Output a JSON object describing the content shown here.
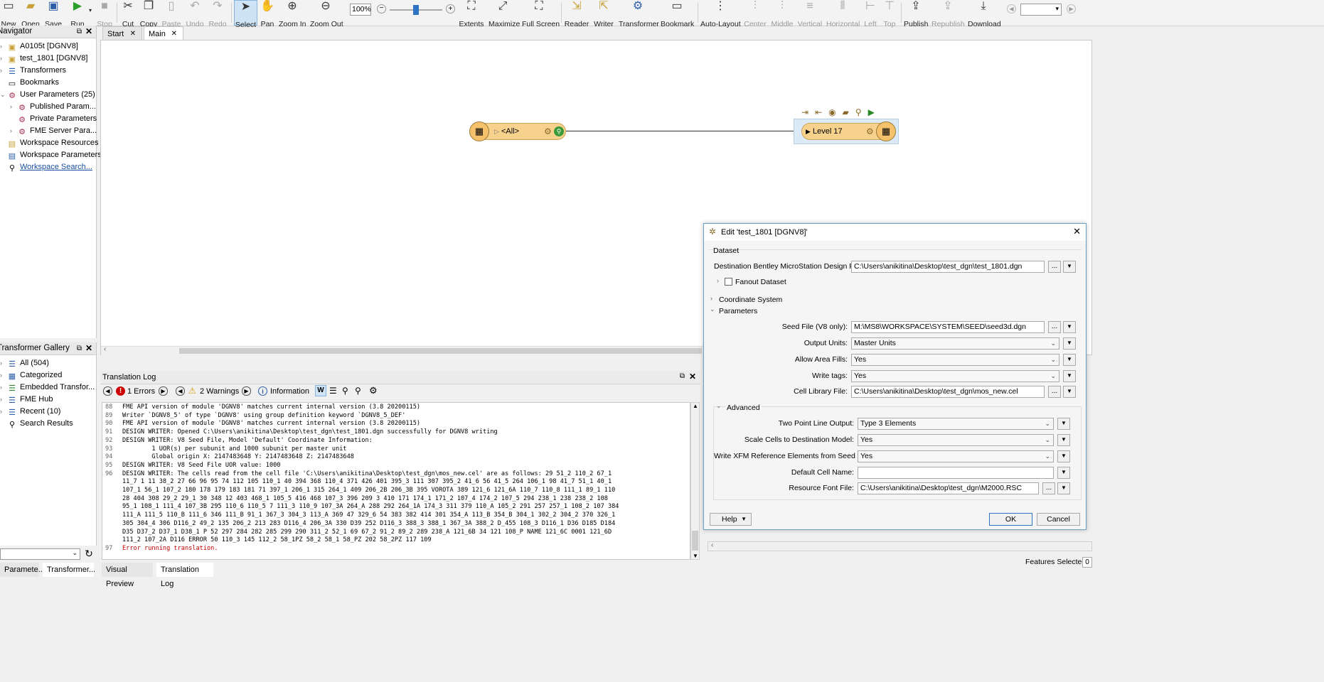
{
  "toolbar": {
    "items": [
      {
        "label": "New"
      },
      {
        "label": "Open"
      },
      {
        "label": "Save"
      },
      {
        "label": "Run"
      },
      {
        "label": "Stop"
      },
      {
        "label": "Cut"
      },
      {
        "label": "Copy"
      },
      {
        "label": "Paste"
      },
      {
        "label": "Undo"
      },
      {
        "label": "Redo"
      },
      {
        "label": "Select"
      },
      {
        "label": "Pan"
      },
      {
        "label": "Zoom In"
      },
      {
        "label": "Zoom Out"
      },
      {
        "label": "Extents"
      },
      {
        "label": "Maximize"
      },
      {
        "label": "Full Screen"
      },
      {
        "label": "Reader"
      },
      {
        "label": "Writer"
      },
      {
        "label": "Transformer"
      },
      {
        "label": "Bookmark"
      },
      {
        "label": "Auto-Layout"
      },
      {
        "label": "Center"
      },
      {
        "label": "Middle"
      },
      {
        "label": "Vertical"
      },
      {
        "label": "Horizontal"
      },
      {
        "label": "Left"
      },
      {
        "label": "Top"
      },
      {
        "label": "Publish"
      },
      {
        "label": "Republish"
      },
      {
        "label": "Download"
      }
    ],
    "zoom": "100%"
  },
  "navigator": {
    "title": "Navigator",
    "items": [
      {
        "label": "A0105t [DGNV8]"
      },
      {
        "label": "test_1801 [DGNV8]"
      },
      {
        "label": "Transformers"
      },
      {
        "label": "Bookmarks"
      },
      {
        "label": "User Parameters (25)"
      },
      {
        "label": "Published Param..."
      },
      {
        "label": "Private Parameters"
      },
      {
        "label": "FME Server Para..."
      },
      {
        "label": "Workspace Resources"
      },
      {
        "label": "Workspace Parameters"
      },
      {
        "label": "Workspace Search..."
      }
    ]
  },
  "gallery": {
    "title": "Transformer Gallery",
    "items": [
      {
        "label": "All (504)"
      },
      {
        "label": "Categorized"
      },
      {
        "label": "Embedded Transfor..."
      },
      {
        "label": "FME Hub"
      },
      {
        "label": "Recent (10)"
      },
      {
        "label": "Search Results"
      }
    ]
  },
  "bottom_left_tabs": [
    "Paramete...",
    "Transformer..."
  ],
  "canvas_tabs": [
    "Start",
    "Main"
  ],
  "canvas": {
    "reader_node": "<All>",
    "writer_node": "Level 17"
  },
  "log": {
    "title": "Translation Log",
    "errors": "1 Errors",
    "warnings": "2 Warnings",
    "information": "Information",
    "lines": [
      {
        "no": "88",
        "text": "FME API version of module 'DGNV8' matches current internal version (3.8 20200115)"
      },
      {
        "no": "89",
        "text": "Writer `DGNV8_5' of type `DGNV8' using group definition keyword `DGNV8_5_DEF'"
      },
      {
        "no": "90",
        "text": "FME API version of module 'DGNV8' matches current internal version (3.8 20200115)"
      },
      {
        "no": "91",
        "text": "DESIGN WRITER: Opened C:\\Users\\anikitina\\Desktop\\test_dgn\\test_1801.dgn successfully for DGNV8 writing"
      },
      {
        "no": "92",
        "text": "DESIGN WRITER: V8 Seed File, Model 'Default' Coordinate Information:"
      },
      {
        "no": "93",
        "text": "        1 UOR(s) per subunit and 1000 subunit per master unit"
      },
      {
        "no": "94",
        "text": "        Global origin X: 2147483648 Y: 2147483648 Z: 2147483648"
      },
      {
        "no": "95",
        "text": "DESIGN WRITER: V8 Seed File UOR value: 1000"
      },
      {
        "no": "96",
        "text": "DESIGN WRITER: The cells read from the cell file 'C:\\Users\\anikitina\\Desktop\\test_dgn\\mos_new.cel' are as follows: 29 51_2 110_2 67_1"
      },
      {
        "no": "",
        "text": "11_7 1 11 38_2 27 66 96 95 74 112 105 110_1 40 394 368 110_4 371 426 401 395_3 111 307 395_2 41_6 56 41_5 264 106_1 98 41_7 51_1 40_1"
      },
      {
        "no": "",
        "text": "107_1 56_1 107_2 180 178 179 183 181 71 397_1 206_1 315 264_1 409 206_2B 206_3B 395 VOROTA 389 121_6 121_6A 110_7 110_8 111_1 89_1 110"
      },
      {
        "no": "",
        "text": "28 404 308 29_2 29_1 30 348 12 403 468_1 105_5 416 468 107_3 396 209 3 410 171 174_1 171_2 107_4 174_2 107_5 294 238_1 238 238_2 108"
      },
      {
        "no": "",
        "text": "95_1 108_1 111_4 107_3B 295 110_6 110_5 7 111_3 110_9 107_3A 264_A 288 292 264_1A 174_3 311 379 110_A 105_2 291 257 257_1 108_2 107 384"
      },
      {
        "no": "",
        "text": "111_A 111_5 110_B 111_6 346 111_B 91_1 367_3 304_3 113_A 369 47 329_6 54 383 382 414 301 354_A 113_B 354_B 304_1 302_2 304_2 370 326_1"
      },
      {
        "no": "",
        "text": "305 304_4 306 D116_2 49_2 135 206_2 213 283 D116_4 206_3A 330 D39 252 D116_3 388_3 388_1 367_3A 388_2 D_455 108_3 D116_1 D36 D185 D184"
      },
      {
        "no": "",
        "text": "D35 D37_2 D37_1 D38_1 P 52 297 284 282 285 299 290 311_2 52_1 69 67_2 91_2 89_2 289 238_A 121_6B 34 121 108_P NAME 121_6C 0001 121_6D"
      },
      {
        "no": "",
        "text": "111_2 107_2A D116 ERROR 50 110_3 145 112_2 58_1PZ 58_2 58_1 58_PZ 202 58_2PZ 117 109"
      },
      {
        "no": "97",
        "text": "Error running translation.",
        "error": true
      }
    ]
  },
  "bottom_tabs": [
    "Visual Preview",
    "Translation Log"
  ],
  "status": {
    "features_selected": "Features Selected:",
    "count": "0"
  },
  "dialog": {
    "title": "Edit 'test_1801 [DGNV8]'",
    "dataset_section": "Dataset",
    "dest_label": "Destination Bentley MicroStation Design File:",
    "dest_value": "C:\\Users\\anikitina\\Desktop\\test_dgn\\test_1801.dgn",
    "fanout": "Fanout Dataset",
    "coord_section": "Coordinate System",
    "params_section": "Parameters",
    "seed_label": "Seed File (V8 only):",
    "seed_value": "M:\\MS8\\WORKSPACE\\SYSTEM\\SEED\\seed3d.dgn",
    "output_units_label": "Output Units:",
    "output_units_value": "Master Units",
    "area_fills_label": "Allow Area Fills:",
    "area_fills_value": "Yes",
    "write_tags_label": "Write tags:",
    "write_tags_value": "Yes",
    "cell_lib_label": "Cell Library File:",
    "cell_lib_value": "C:\\Users\\anikitina\\Desktop\\test_dgn\\mos_new.cel",
    "advanced_section": "Advanced",
    "two_point_label": "Two Point Line Output:",
    "two_point_value": "Type 3 Elements",
    "scale_cells_label": "Scale Cells to Destination Model:",
    "scale_cells_value": "Yes",
    "xfm_label": "Write XFM Reference Elements from Seed File:",
    "xfm_value": "Yes",
    "default_cell_label": "Default Cell Name:",
    "default_cell_value": "",
    "font_label": "Resource Font File:",
    "font_value": "C:\\Users\\anikitina\\Desktop\\test_dgn\\M2000.RSC",
    "help": "Help",
    "ok": "OK",
    "cancel": "Cancel",
    "browse": "..."
  }
}
